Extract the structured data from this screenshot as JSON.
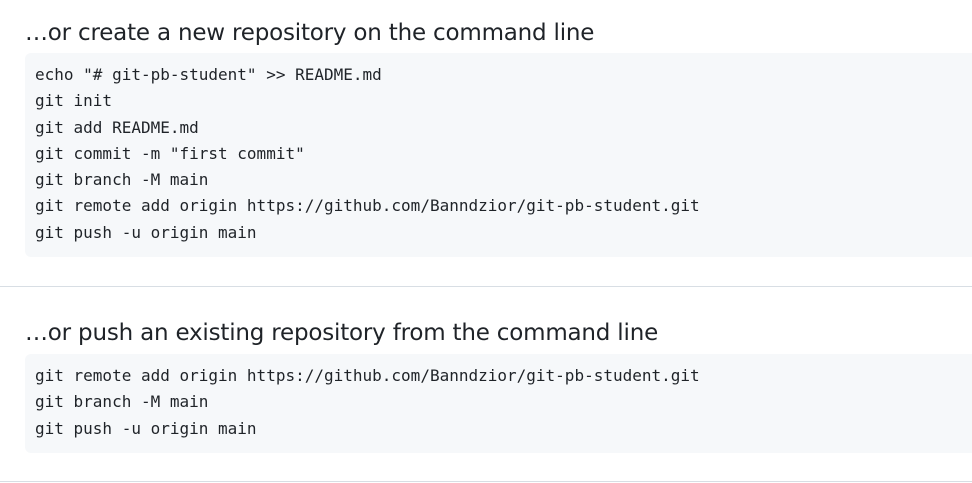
{
  "create_section": {
    "heading": "…or create a new repository on the command line",
    "lines": [
      "echo \"# git-pb-student\" >> README.md",
      "git init",
      "git add README.md",
      "git commit -m \"first commit\"",
      "git branch -M main",
      "git remote add origin https://github.com/Banndzior/git-pb-student.git",
      "git push -u origin main"
    ]
  },
  "push_section": {
    "heading": "…or push an existing repository from the command line",
    "lines": [
      "git remote add origin https://github.com/Banndzior/git-pb-student.git",
      "git branch -M main",
      "git push -u origin main"
    ]
  },
  "colors": {
    "code_background": "#f6f8fa",
    "divider": "#d8dee4",
    "text": "#1f2328"
  }
}
